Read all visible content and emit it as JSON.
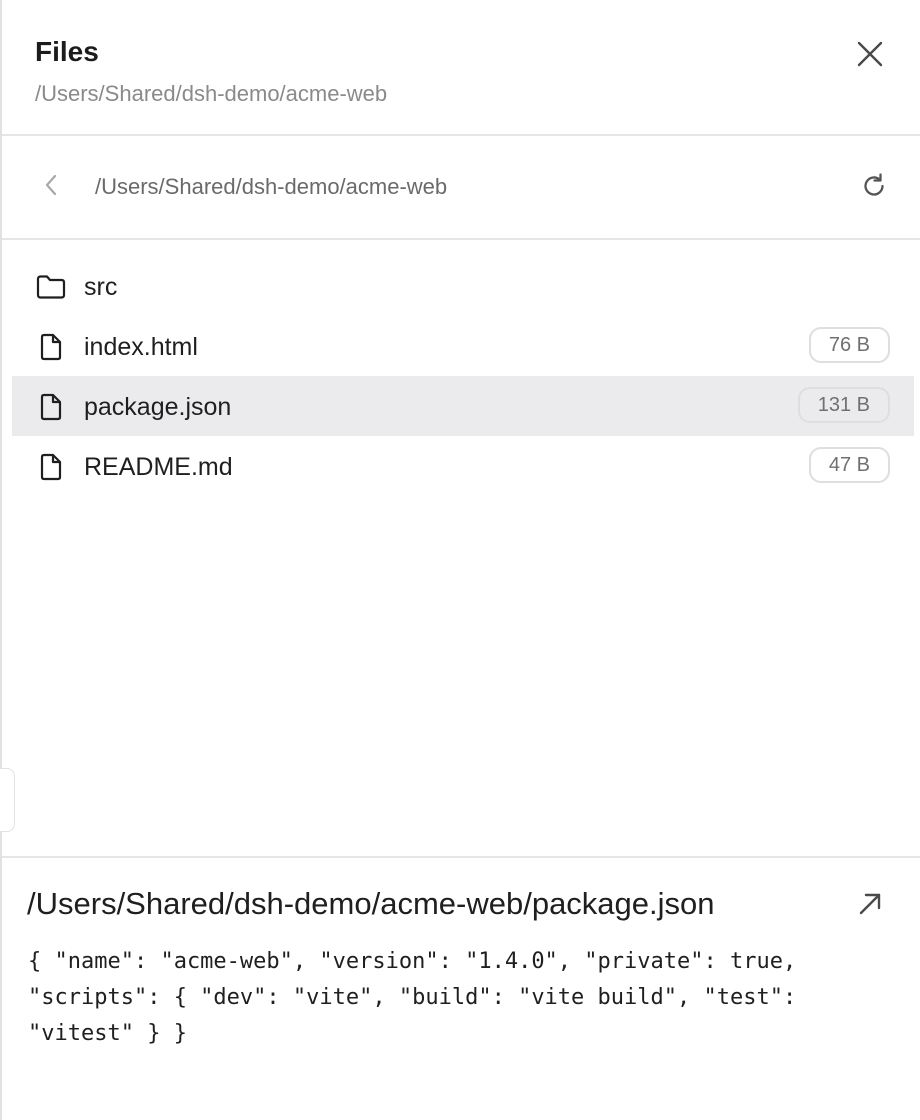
{
  "header": {
    "title": "Files",
    "subtitle": "/Users/Shared/dsh-demo/acme-web",
    "close_icon": "close-icon"
  },
  "nav": {
    "path": "/Users/Shared/dsh-demo/acme-web",
    "back_icon": "chevron-left-icon",
    "refresh_icon": "refresh-icon"
  },
  "files": [
    {
      "name": "src",
      "type": "folder",
      "size": ""
    },
    {
      "name": "index.html",
      "type": "file",
      "size": "76 B"
    },
    {
      "name": "package.json",
      "type": "file",
      "size": "131 B",
      "selected": true
    },
    {
      "name": "README.md",
      "type": "file",
      "size": "47 B"
    }
  ],
  "preview": {
    "path": "/Users/Shared/dsh-demo/acme-web/package.json",
    "open_icon": "arrow-up-right-icon",
    "content": "{ \"name\": \"acme-web\", \"version\": \"1.4.0\", \"private\": true,\n\"scripts\": { \"dev\": \"vite\", \"build\": \"vite build\", \"test\":\n\"vitest\" } }"
  },
  "colors": {
    "selected_row": "#ebebed",
    "border": "#e6e6e6",
    "muted_text": "#8a8a8a"
  }
}
